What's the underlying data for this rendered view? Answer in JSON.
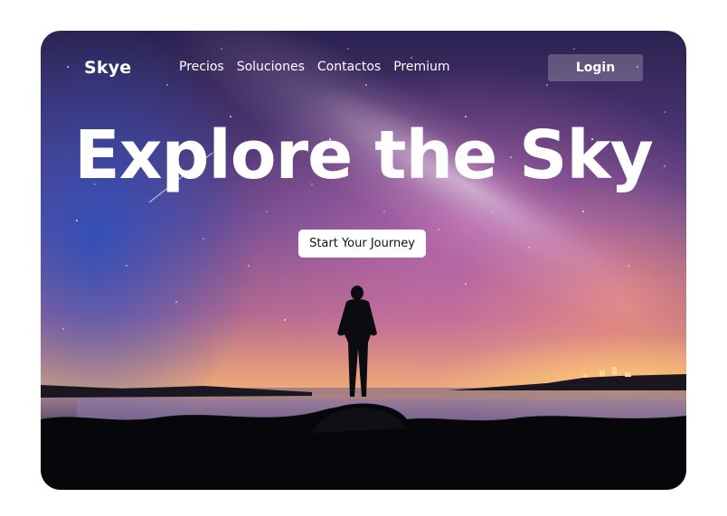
{
  "brand": {
    "name": "Skye"
  },
  "nav": {
    "links": [
      {
        "label": "Precios"
      },
      {
        "label": "Soluciones"
      },
      {
        "label": "Contactos"
      },
      {
        "label": "Premium"
      }
    ],
    "login_label": "Login"
  },
  "hero": {
    "title": "Explore the Sky",
    "cta_label": "Start Your Journey"
  },
  "colors": {
    "sky_top": "#2b2250",
    "sky_mid": "#b46a8e",
    "horizon_glow": "#f1b27a",
    "ground": "#0c0c12",
    "button_bg": "#ffffff"
  }
}
